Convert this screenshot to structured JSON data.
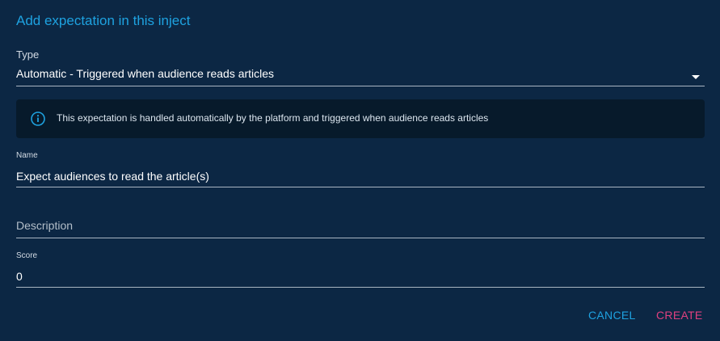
{
  "dialog": {
    "title": "Add expectation in this inject"
  },
  "type_field": {
    "label": "Type",
    "value": "Automatic - Triggered when audience reads articles"
  },
  "info_alert": {
    "icon": "info-circle-icon",
    "text": "This expectation is handled automatically by the platform and triggered when audience reads articles"
  },
  "name_field": {
    "label": "Name",
    "value": "Expect audiences to read the article(s)"
  },
  "description_field": {
    "label": "Description",
    "value": ""
  },
  "score_field": {
    "label": "Score",
    "value": "0"
  },
  "actions": {
    "cancel_label": "CANCEL",
    "create_label": "CREATE"
  },
  "colors": {
    "background": "#0c2744",
    "accent": "#1ea2e0",
    "secondary": "#e0407f",
    "alert_background": "#071a2b"
  }
}
